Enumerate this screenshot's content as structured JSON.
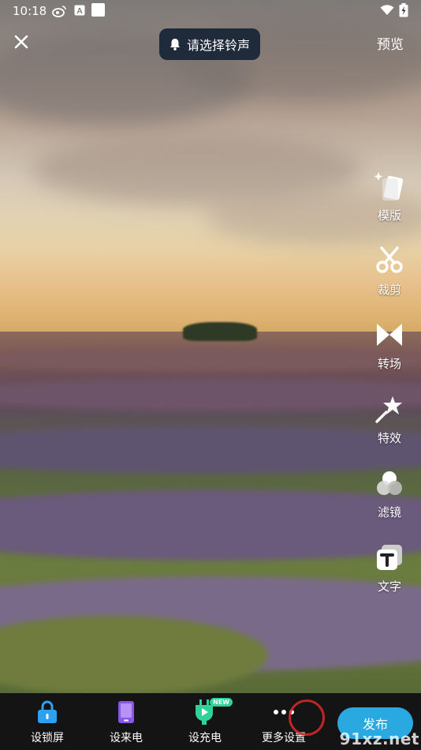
{
  "status_bar": {
    "time": "10:18",
    "icons": [
      "weibo-icon",
      "a-icon",
      "white-square-icon",
      "wifi-icon",
      "battery-charging-icon"
    ]
  },
  "top_bar": {
    "ringtone_label": "请选择铃声",
    "preview_label": "预览"
  },
  "tools": [
    {
      "label": "模版",
      "icon": "template-icon"
    },
    {
      "label": "裁剪",
      "icon": "scissors-icon"
    },
    {
      "label": "转场",
      "icon": "transition-icon"
    },
    {
      "label": "特效",
      "icon": "magic-wand-icon"
    },
    {
      "label": "滤镜",
      "icon": "filter-icon"
    },
    {
      "label": "文字",
      "icon": "text-icon"
    }
  ],
  "bottom_bar": {
    "items": [
      {
        "label": "设锁屏",
        "icon": "lock-icon",
        "color": "#2ea0f0"
      },
      {
        "label": "设来电",
        "icon": "phone-icon",
        "color": "#8a56e8"
      },
      {
        "label": "设充电",
        "icon": "charge-plug-icon",
        "color": "#2fd39a",
        "badge": "NEW"
      },
      {
        "label": "更多设置",
        "icon": "more-icon"
      }
    ],
    "publish_label": "发布"
  },
  "watermark": {
    "text": "91xz.net"
  },
  "colors": {
    "chip_bg": "#1f2a3a",
    "publish": "#2aa8e0",
    "new_badge": "#2fd39a"
  }
}
